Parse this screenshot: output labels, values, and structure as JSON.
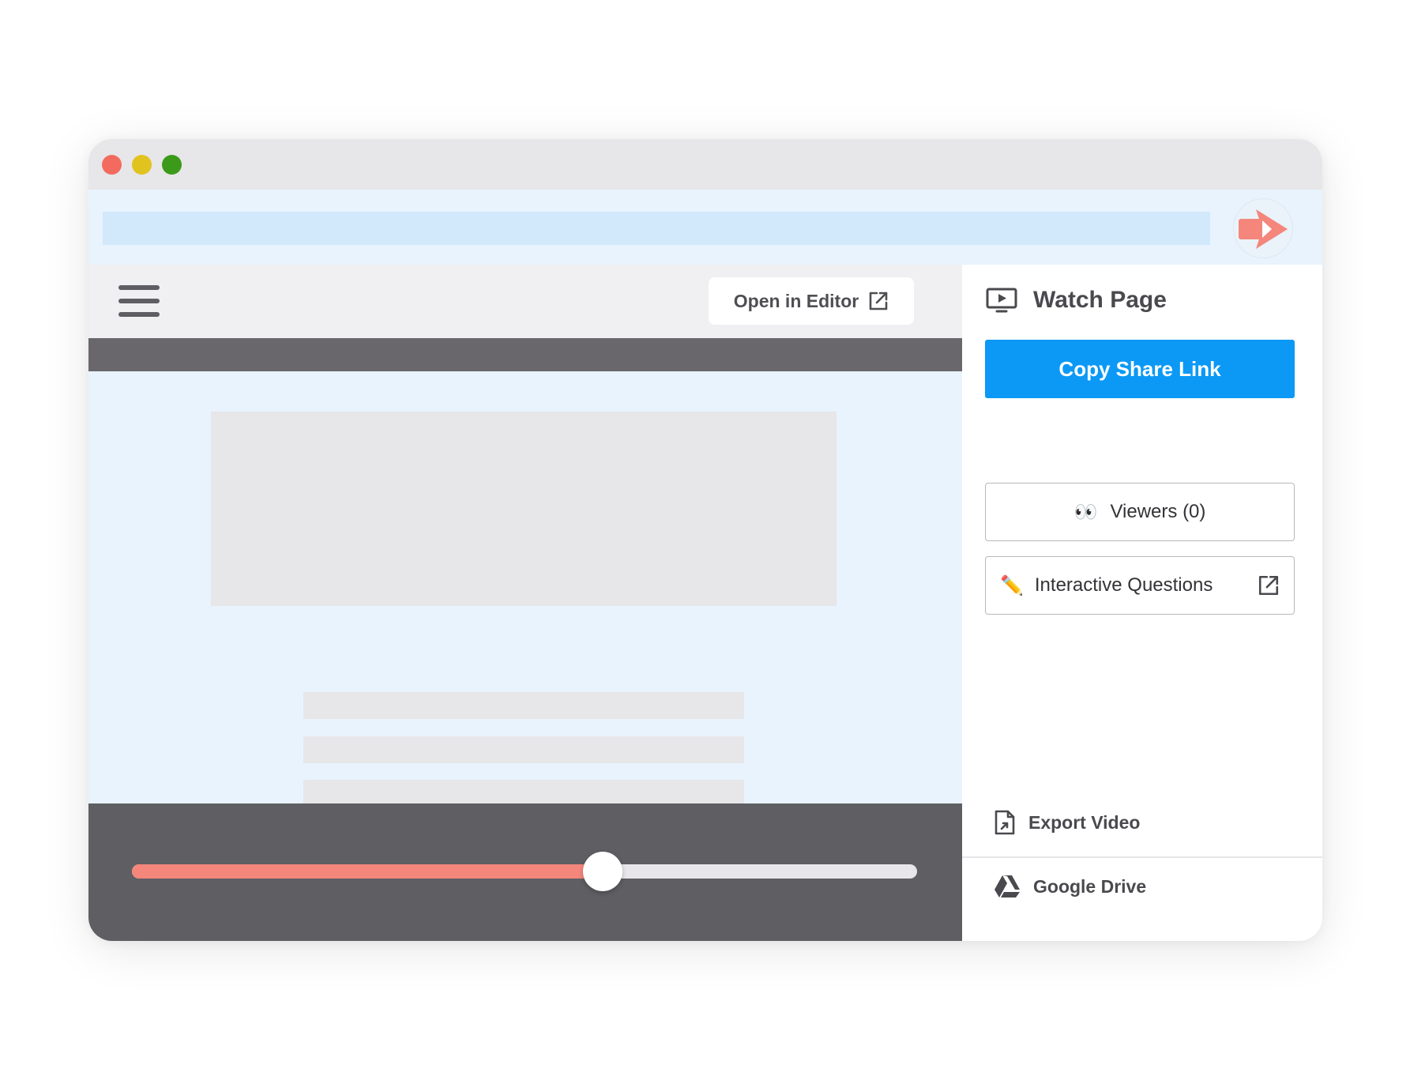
{
  "window": {
    "traffic_lights": {
      "red": "#f36b5f",
      "yellow": "#e1c31f",
      "green": "#3c9a1a"
    }
  },
  "extension": {
    "icon": "video-share-icon",
    "color": "#f4867b"
  },
  "toolbar": {
    "menu_icon": "hamburger-icon",
    "open_editor_label": "Open in Editor",
    "open_editor_icon": "external-link-icon"
  },
  "player": {
    "progress": 0.6,
    "fill_color": "#f4867b"
  },
  "side_panel": {
    "title": "Watch Page",
    "title_icon": "monitor-play-icon",
    "copy_link_label": "Copy Share Link",
    "accent": "#0b99f5",
    "viewers_emoji": "👀",
    "viewers_label": "Viewers (0)",
    "questions_emoji": "✏️",
    "questions_label": "Interactive Questions",
    "export_label": "Export Video",
    "export_icon": "export-file-icon",
    "drive_label": "Google Drive",
    "drive_icon": "google-drive-icon"
  }
}
